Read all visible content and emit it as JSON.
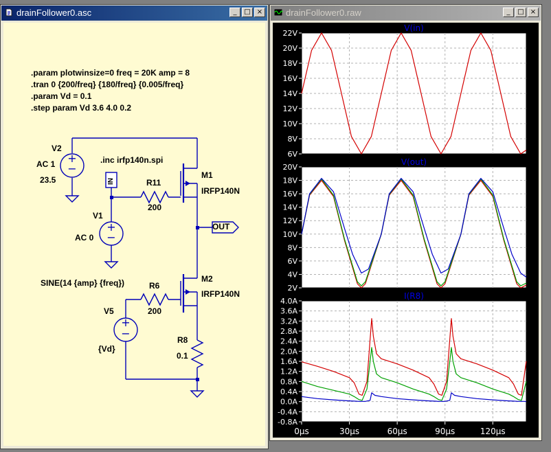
{
  "windows": {
    "schematic": {
      "title": "drainFollower0.asc"
    },
    "waveform": {
      "title": "drainFollower0.raw"
    }
  },
  "titlebar_buttons": {
    "minimize": "_",
    "maximize": "□",
    "close": "×"
  },
  "colors": {
    "wire": "#0000b8",
    "component": "#0000b8",
    "schematic_bg": "#fffbd2",
    "plot_bg": "#ffffff",
    "series_red": "#d40000",
    "series_green": "#00a000",
    "series_blue": "#0000c8"
  },
  "schematic": {
    "directives": [
      ".param plotwinsize=0 freq = 20K amp = 8",
      ".tran 0 {200/freq} {180/freq}  {0.005/freq}",
      ".param Vd = 0.1",
      ".step param Vd 3.6 4.0 0.2"
    ],
    "include": ".inc irfp140n.spi",
    "components": {
      "V2": {
        "name": "V2",
        "ac": "AC 1",
        "value": "23.5"
      },
      "V1": {
        "name": "V1",
        "ac": "AC 0"
      },
      "V5": {
        "name": "V5",
        "value": "{Vd}",
        "sine": "SINE(14 {amp} {freq})"
      },
      "R11": {
        "name": "R11",
        "value": "200"
      },
      "R6": {
        "name": "R6",
        "value": "200"
      },
      "R8": {
        "name": "R8",
        "value": "0.1"
      },
      "M1": {
        "name": "M1",
        "model": "IRFP140N"
      },
      "M2": {
        "name": "M2",
        "model": "IRFP140N"
      }
    },
    "ports": {
      "in": "IN",
      "out": "OUT"
    }
  },
  "waveform": {
    "x_ticks": [
      "0µs",
      "30µs",
      "60µs",
      "90µs",
      "120µs"
    ],
    "panes": [
      {
        "title": "V(in)",
        "y_ticks": [
          "22V",
          "20V",
          "18V",
          "16V",
          "14V",
          "12V",
          "10V",
          "8V",
          "6V"
        ]
      },
      {
        "title": "V(out)",
        "y_ticks": [
          "20V",
          "18V",
          "16V",
          "14V",
          "12V",
          "10V",
          "8V",
          "6V",
          "4V",
          "2V"
        ]
      },
      {
        "title": "I(R8)",
        "y_ticks": [
          "4.0A",
          "3.6A",
          "3.2A",
          "2.8A",
          "2.4A",
          "2.0A",
          "1.6A",
          "1.2A",
          "0.8A",
          "0.4A",
          "0.0A",
          "-0.4A",
          "-0.8A"
        ]
      }
    ]
  },
  "chart_data": [
    {
      "type": "line",
      "title": "V(in)",
      "xlabel": "",
      "ylabel": "",
      "xlim": [
        0,
        141
      ],
      "ylim": [
        6,
        22
      ],
      "grid": true,
      "series": [
        {
          "color": "#d40000",
          "x": [
            0,
            6.25,
            12.5,
            18.75,
            25,
            31.25,
            37.5,
            43.75,
            50,
            56.25,
            62.5,
            68.75,
            75,
            81.25,
            87.5,
            93.75,
            100,
            106.25,
            112.5,
            118.75,
            125,
            131.25,
            137.5,
            141
          ],
          "y": [
            14,
            19.7,
            22,
            19.7,
            14,
            8.3,
            6,
            8.3,
            14,
            19.7,
            22,
            19.7,
            14,
            8.3,
            6,
            8.3,
            14,
            19.7,
            22,
            19.7,
            14,
            8.3,
            6,
            6.5
          ]
        }
      ]
    },
    {
      "type": "line",
      "title": "V(out)",
      "xlabel": "",
      "ylabel": "",
      "xlim": [
        0,
        141
      ],
      "ylim": [
        2,
        20
      ],
      "grid": true,
      "series": [
        {
          "color": "#d40000",
          "x": [
            0,
            5,
            12.5,
            20,
            27,
            35,
            37.5,
            40,
            50,
            55,
            62.5,
            70,
            77,
            85,
            87.5,
            90,
            100,
            105,
            112.5,
            120,
            127,
            135,
            137.5,
            141
          ],
          "y": [
            10,
            15.8,
            18,
            15.6,
            9,
            2.6,
            2,
            2.6,
            10,
            15.8,
            18,
            15.6,
            9,
            2.6,
            2,
            2.6,
            10,
            15.8,
            18,
            15.6,
            9,
            2.6,
            2,
            2.4
          ]
        },
        {
          "color": "#00a000",
          "x": [
            0,
            5,
            12.5,
            20,
            27,
            35,
            37.5,
            40,
            50,
            55,
            62.5,
            70,
            77,
            85,
            87.5,
            90,
            100,
            105,
            112.5,
            120,
            127,
            135,
            137.5,
            141
          ],
          "y": [
            10,
            15.9,
            18.2,
            15.8,
            9.2,
            2.9,
            2.3,
            2.9,
            10,
            15.9,
            18.2,
            15.8,
            9.2,
            2.9,
            2.3,
            2.9,
            10,
            15.9,
            18.2,
            15.8,
            9.2,
            2.9,
            2.3,
            2.7
          ]
        },
        {
          "color": "#0000c8",
          "x": [
            0,
            5,
            12.5,
            20,
            27,
            32,
            37.5,
            42,
            50,
            55,
            62.5,
            70,
            77,
            82,
            87.5,
            92,
            100,
            105,
            112.5,
            120,
            127,
            132,
            137.5,
            141
          ],
          "y": [
            10,
            16,
            18.3,
            16.3,
            10.8,
            7,
            4.2,
            4.8,
            10,
            16,
            18.3,
            16.3,
            10.8,
            7,
            4.2,
            4.8,
            10,
            16,
            18.3,
            16.3,
            10.8,
            7,
            4.2,
            3.6
          ]
        }
      ]
    },
    {
      "type": "line",
      "title": "I(R8)",
      "xlabel": "",
      "ylabel": "",
      "xlim": [
        0,
        141
      ],
      "ylim": [
        -0.8,
        4.0
      ],
      "grid": true,
      "series": [
        {
          "color": "#d40000",
          "x": [
            0,
            10,
            20,
            30,
            33,
            36,
            38,
            41,
            44,
            45,
            47,
            50,
            60,
            70,
            80,
            83,
            86,
            88,
            91,
            94,
            95,
            97,
            100,
            110,
            120,
            130,
            133,
            136,
            138,
            141
          ],
          "y": [
            1.58,
            1.4,
            1.2,
            0.95,
            0.75,
            0.3,
            0.25,
            0.8,
            3.3,
            2.6,
            1.9,
            1.7,
            1.5,
            1.25,
            0.95,
            0.7,
            0.3,
            0.25,
            0.8,
            3.3,
            2.6,
            1.9,
            1.7,
            1.5,
            1.25,
            0.95,
            0.7,
            0.3,
            0.25,
            1.6
          ]
        },
        {
          "color": "#00a000",
          "x": [
            0,
            10,
            20,
            30,
            33,
            36,
            38,
            41,
            44,
            45,
            47,
            50,
            60,
            70,
            80,
            83,
            86,
            88,
            91,
            94,
            95,
            97,
            100,
            110,
            120,
            130,
            133,
            136,
            138,
            141
          ],
          "y": [
            0.8,
            0.6,
            0.45,
            0.3,
            0.2,
            0.08,
            0.05,
            0.5,
            2.15,
            1.6,
            1.1,
            0.95,
            0.75,
            0.5,
            0.3,
            0.2,
            0.08,
            0.05,
            0.5,
            2.15,
            1.6,
            1.1,
            0.95,
            0.75,
            0.5,
            0.3,
            0.2,
            0.08,
            0.05,
            0.8
          ]
        },
        {
          "color": "#0000c8",
          "x": [
            0,
            10,
            20,
            30,
            33,
            36,
            40,
            43,
            44,
            46,
            50,
            60,
            70,
            80,
            83,
            86,
            90,
            93,
            94,
            96,
            100,
            110,
            120,
            130,
            133,
            136,
            140,
            141
          ],
          "y": [
            0.2,
            0.12,
            0.07,
            0.03,
            0.02,
            0.01,
            0.01,
            0.05,
            0.35,
            0.25,
            0.2,
            0.12,
            0.07,
            0.03,
            0.02,
            0.01,
            0.01,
            0.05,
            0.35,
            0.25,
            0.2,
            0.12,
            0.07,
            0.03,
            0.02,
            0.01,
            0.01,
            0.0
          ]
        }
      ]
    }
  ]
}
